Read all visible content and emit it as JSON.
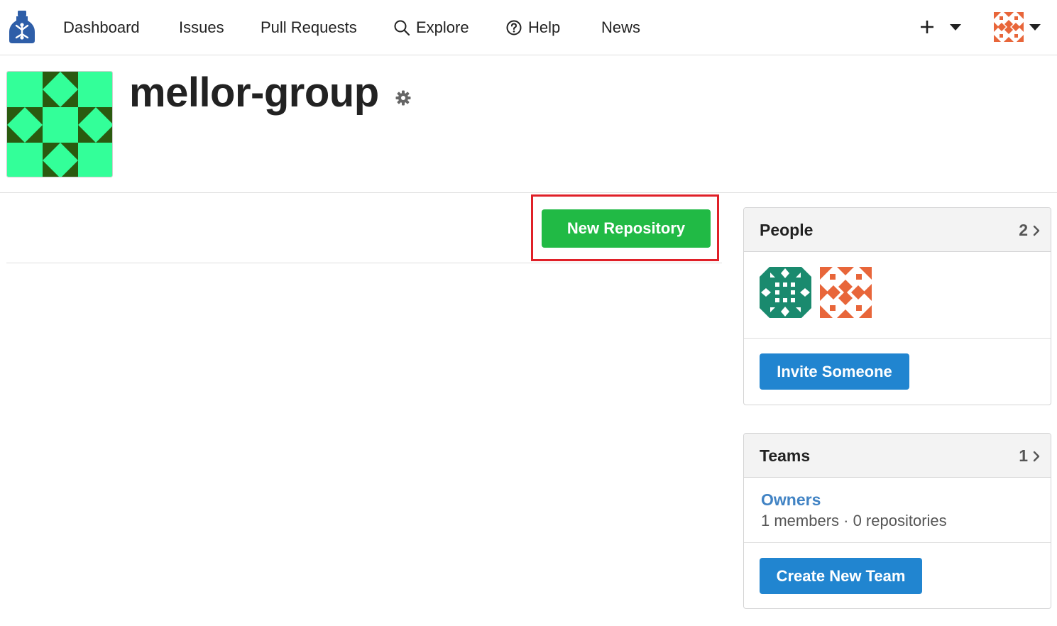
{
  "nav": {
    "items": [
      {
        "label": "Dashboard"
      },
      {
        "label": "Issues"
      },
      {
        "label": "Pull Requests"
      },
      {
        "label": "Explore",
        "icon": "search-icon"
      },
      {
        "label": "Help",
        "icon": "question-circle-icon"
      },
      {
        "label": "News"
      }
    ],
    "plus_icon": "plus-icon",
    "user_avatar_icon": "identicon-orange"
  },
  "org": {
    "name": "mellor-group",
    "avatar_colors": {
      "light": "#33ff99",
      "dark": "#2a5a0f"
    },
    "settings_icon": "gear-icon"
  },
  "main": {
    "new_repo_label": "New Repository",
    "highlight_color": "#e02028"
  },
  "people": {
    "title": "People",
    "count": "2",
    "invite_label": "Invite Someone",
    "members": [
      {
        "avatar": "identicon-teal",
        "color": "#1a8a6e"
      },
      {
        "avatar": "identicon-orange",
        "color": "#e8663a"
      }
    ]
  },
  "teams": {
    "title": "Teams",
    "count": "1",
    "items": [
      {
        "name": "Owners",
        "meta": "1 members · 0 repositories"
      }
    ],
    "create_label": "Create New Team"
  },
  "colors": {
    "green": "#21ba45",
    "blue": "#2185d0",
    "link": "#4183c4"
  }
}
